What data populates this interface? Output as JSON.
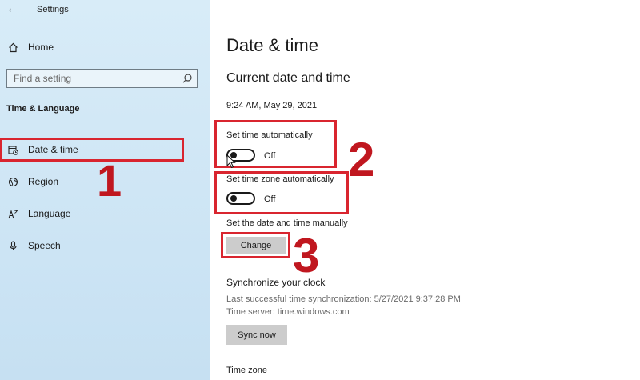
{
  "window": {
    "title": "Settings",
    "back_icon": "back-arrow-icon"
  },
  "sidebar": {
    "home_label": "Home",
    "search_placeholder": "Find a setting",
    "section_heading": "Time & Language",
    "items": [
      {
        "label": "Date & time",
        "icon": "calendar-clock-icon",
        "selected": true
      },
      {
        "label": "Region",
        "icon": "globe-icon"
      },
      {
        "label": "Language",
        "icon": "language-icon"
      },
      {
        "label": "Speech",
        "icon": "microphone-icon"
      }
    ]
  },
  "main": {
    "page_title": "Date & time",
    "section_title": "Current date and time",
    "current_datetime": "9:24 AM, May 29, 2021",
    "set_time_auto": {
      "label": "Set time automatically",
      "state": "Off"
    },
    "set_timezone_auto": {
      "label": "Set time zone automatically",
      "state": "Off"
    },
    "manual_label": "Set the date and time manually",
    "change_button": "Change",
    "sync": {
      "title": "Synchronize your clock",
      "last_sync": "Last successful time synchronization: 5/27/2021 9:37:28 PM",
      "server": "Time server: time.windows.com",
      "button": "Sync now"
    },
    "timezone_title": "Time zone"
  },
  "annotations": {
    "step1": "1",
    "step2": "2",
    "step3": "3"
  },
  "colors": {
    "highlight": "#d9252f",
    "step_number": "#c0171f",
    "sidebar_bg": "#cfe6f5",
    "button_bg": "#cccccc"
  }
}
